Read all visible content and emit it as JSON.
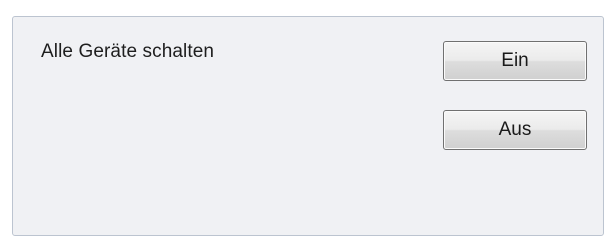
{
  "panel": {
    "label": "Alle Geräte schalten",
    "on_button": "Ein",
    "off_button": "Aus"
  }
}
